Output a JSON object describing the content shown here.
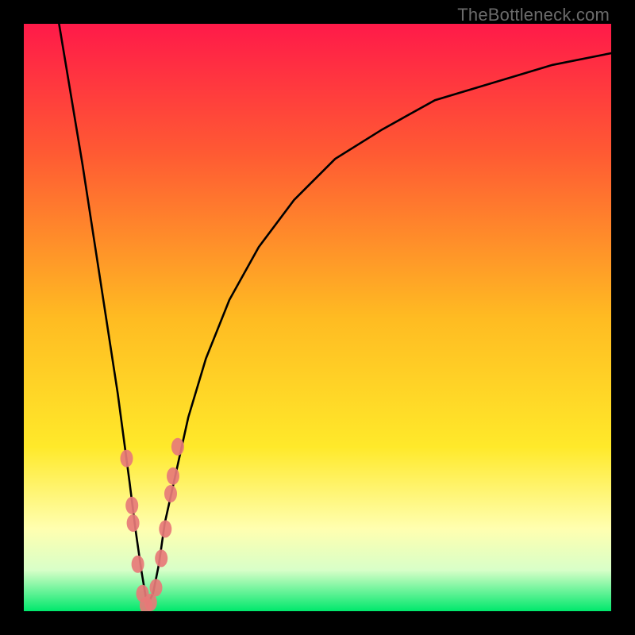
{
  "watermark": "TheBottleneck.com",
  "colors": {
    "frame": "#000000",
    "grad_top": "#ff1a49",
    "grad_mid1": "#ff5a33",
    "grad_mid2": "#ffbb22",
    "grad_mid3": "#ffe92a",
    "grad_pale": "#ffffb0",
    "grad_bottom": "#00e86c",
    "curve": "#000000",
    "marker_fill": "#e77a78",
    "marker_stroke": "#a94c4a"
  },
  "chart_data": {
    "type": "line",
    "title": "",
    "xlabel": "",
    "ylabel": "",
    "xlim": [
      0,
      100
    ],
    "ylim": [
      0,
      100
    ],
    "note": "Axes are unlabeled in the source; values are estimated from pixel positions on a 0–100 normalized scale. y is a bottleneck/mismatch percentage (0 = green/good, 100 = red/bad). The curve has a sharp minimum near x≈21 and rises steeply on both sides.",
    "series": [
      {
        "name": "bottleneck-curve",
        "x": [
          6,
          8,
          10,
          12,
          14,
          16,
          18,
          19,
          20,
          21,
          22,
          23,
          24,
          26,
          28,
          31,
          35,
          40,
          46,
          53,
          61,
          70,
          80,
          90,
          100
        ],
        "y": [
          100,
          88,
          76,
          63,
          50,
          37,
          22,
          14,
          7,
          1,
          3,
          8,
          15,
          24,
          33,
          43,
          53,
          62,
          70,
          77,
          82,
          87,
          90,
          93,
          95
        ]
      }
    ],
    "markers": {
      "name": "highlighted-points",
      "note": "Pink dot markers clustered near the curve minimum (the 'V').",
      "points": [
        {
          "x": 17.5,
          "y": 26
        },
        {
          "x": 18.4,
          "y": 18
        },
        {
          "x": 18.6,
          "y": 15
        },
        {
          "x": 19.4,
          "y": 8
        },
        {
          "x": 20.2,
          "y": 3
        },
        {
          "x": 20.8,
          "y": 1
        },
        {
          "x": 21.6,
          "y": 1.5
        },
        {
          "x": 22.5,
          "y": 4
        },
        {
          "x": 23.4,
          "y": 9
        },
        {
          "x": 24.1,
          "y": 14
        },
        {
          "x": 25.0,
          "y": 20
        },
        {
          "x": 25.4,
          "y": 23
        },
        {
          "x": 26.2,
          "y": 28
        }
      ]
    }
  }
}
